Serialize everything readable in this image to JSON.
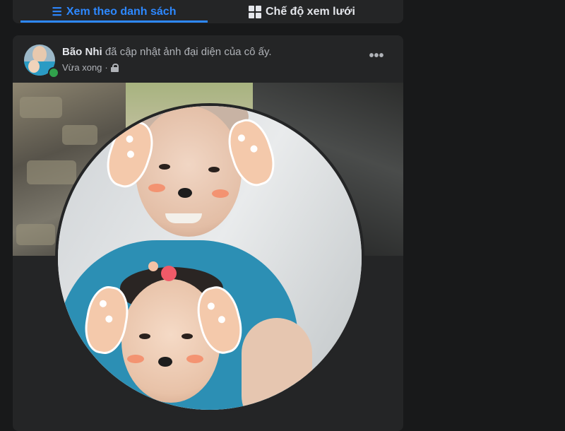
{
  "tabs": {
    "list_label": "Xem theo danh sách",
    "list_icon": "list-icon",
    "grid_label": "Chế độ xem lưới",
    "grid_icon": "grid-icon",
    "active": "list"
  },
  "post": {
    "author": "Bão Nhi",
    "action": "đã cập nhật ảnh đại diện của cô ấy.",
    "time": "Vừa xong",
    "separator": "·",
    "privacy_icon": "lock-icon",
    "more_label": "•••",
    "author_online": true
  },
  "colors": {
    "accent": "#2d88ff",
    "card_bg": "#242526",
    "page_bg": "#18191a",
    "text_primary": "#e4e6eb",
    "text_secondary": "#b0b3b8",
    "online": "#31a24c"
  }
}
